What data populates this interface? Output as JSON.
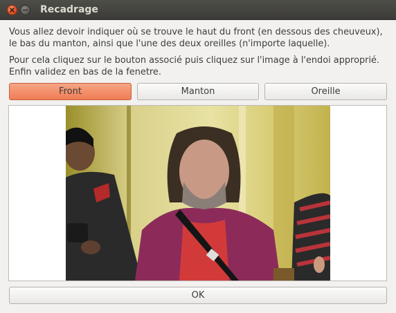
{
  "window": {
    "title": "Recadrage"
  },
  "instructions": {
    "line1": "Vous allez devoir indiquer où se trouve le haut du front (en dessous des cheuveux),",
    "line2": "le bas du manton, ainsi que l'une des deux oreilles (n'importe laquelle).",
    "line3": "Pour cela cliquez sur le bouton associé puis cliquez sur l'image à l'endoi approprié.",
    "line4": "Enfin validez en bas de la fenetre."
  },
  "buttons": {
    "front": "Front",
    "manton": "Manton",
    "oreille": "Oreille",
    "ok": "OK"
  },
  "colors": {
    "active_button": "#ef7c55",
    "titlebar": "#3c3b37"
  },
  "image": {
    "alt": ""
  }
}
